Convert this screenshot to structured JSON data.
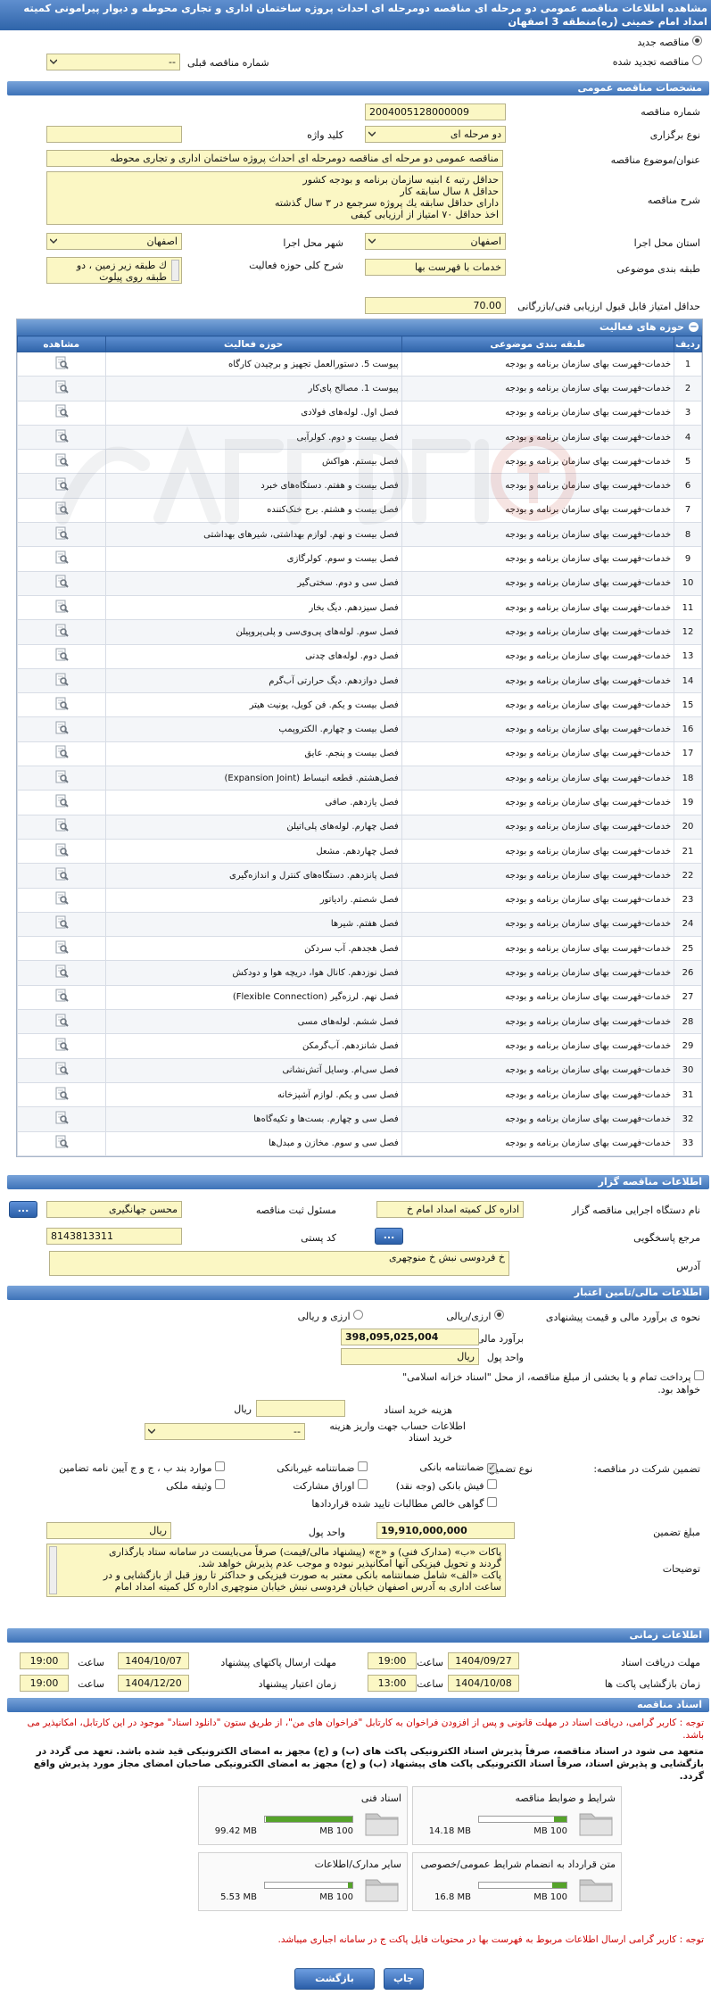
{
  "colors": {
    "panel_head": "#3a73b5",
    "field": "#fbf7c4",
    "accent_red": "#cc0000"
  },
  "header": {
    "line1": "مشاهده اطلاعات مناقصه عمومی دو مرحله ای مناقصه دومرحله ای احداث پروژه ساختمان اداری و تجاری محوطه و دیوار پیرامونی کمیته",
    "line2": "امداد امام خمینی (ره)منطقه 3 اصفهان",
    "radio_new": "مناقصه جدید",
    "radio_renewed": "مناقصه تجدید شده",
    "prev_number_label": "شماره مناقصه قبلی",
    "prev_number_value": "--"
  },
  "general": {
    "section_title": "مشخصات مناقصه عمومی",
    "number_label": "شماره مناقصه",
    "number_value": "2004005128000009",
    "type_label": "نوع برگزاری",
    "type_value": "دو مرحله ای",
    "keyword_label": "کلید واژه",
    "keyword_value": "",
    "subject_label": "عنوان/موضوع مناقصه",
    "subject_value": "مناقصه عمومی دو مرحله ای مناقصه دومرحله ای احداث پروژه ساختمان اداری و تجاری محوطه",
    "desc_label": "شرح مناقصه",
    "desc_lines": [
      "حداقل رتبه ٤ ابنیه سازمان برنامه و بودجه کشور",
      "حداقل ٨ سال سابقه کار",
      "دارای حداقل سابقه یك پروژه سرجمع در ٣ سال گذشته",
      "اخذ حداقل ٧٠ امتیاز از ارزیابی کیفی"
    ],
    "province_label": "استان محل اجرا",
    "province_value": "اصفهان",
    "city_label": "شهر محل اجرا",
    "city_value": "اصفهان",
    "category_label": "طبقه بندی موضوعی",
    "category_value": "خدمات با فهرست بها",
    "scope_label": "شرح کلی حوزه فعالیت",
    "scope_lines": [
      "ك طبقه زیر زمین ، دو",
      "طبقه روی پیلوت"
    ],
    "minscore_label": "حداقل امتیاز قابل قبول ارزیابی فنی/بازرگانی",
    "minscore_value": "70.00"
  },
  "activities": {
    "title": "حوزه های فعالیت",
    "toggle": "−",
    "headers": [
      "ردیف",
      "طبقه بندی موضوعی",
      "حوزه فعالیت",
      "مشاهده"
    ],
    "category_text": "خدمات-فهرست بهای سازمان برنامه و بودجه",
    "scopes": [
      "پیوست 5. دستورالعمل تجهیز و برچیدن کارگاه",
      "پیوست 1. مصالح پای‌کار",
      "فصل اول. لوله‌های فولادی",
      "فصل بیست و دوم. کولرآبی",
      "فصل بیستم. هواکش",
      "فصل بیست و هفتم. دستگاه‌های خبرد",
      "فصل بیست و هشتم. برج خنک‌کننده",
      "فصل بیست و نهم. لوازم بهداشتی، شیرهای بهداشتی",
      "فصل بیست و سوم. کولرگازی",
      "فصل سی و دوم. سختی‌گیر",
      "فصل سیزدهم. دیگ بخار",
      "فصل سوم. لوله‌های پی‌وی‌سی و پلی‌پروپیلن",
      "فصل دوم. لوله‌های چدنی",
      "فصل دوازدهم. دیگ حرارتی آب‌گرم",
      "فصل بیست و یکم. فن کویل، یونیت هیتر",
      "فصل بیست و چهارم. الکتروپمپ",
      "فصل بیست و پنجم. عایق",
      "فصل‌هشتم. قطعه انبساط (Expansion Joint)",
      "فصل یازدهم. صافی",
      "فصل چهارم. لوله‌های پلی‌اتیلن",
      "فصل چهاردهم. مشعل",
      "فصل پانزدهم. دستگاه‌های کنترل و اندازه‌گیری",
      "فصل شصتم. رادیاتور",
      "فصل هفتم. شیرها",
      "فصل هجدهم. آب سردکن",
      "فصل نوزدهم. کانال هوا، دریچه هوا و دودکش",
      "فصل نهم. لرزه‌گیر (Flexible Connection)",
      "فصل ششم. لوله‌های مسی",
      "فصل شانزدهم. آب‌گرمکن",
      "فصل سی‌ام. وسایل آتش‌نشانی",
      "فصل سی و یکم. لوازم آشپزخانه",
      "فصل سی و چهارم. بست‌ها و تکیه‌گاه‌ها",
      "فصل سی و سوم. مخازن و مبدل‌ها"
    ]
  },
  "organizer": {
    "section_title": "اطلاعات مناقصه گزار",
    "device_label": "نام دستگاه اجرایی مناقصه گزار",
    "device_value": "اداره کل کمیته امداد امام خ",
    "officer_label": "مسئول ثبت مناقصه",
    "officer_value": "محسن جهانگیری",
    "ref_label": "مرجع پاسخگویی",
    "ref_btn": "...",
    "officer_btn": "...",
    "postal_label": "کد پستی",
    "postal_value": "8143813311",
    "address_label": "آدرس",
    "address_value": "خ فردوسی نبش خ منوچهری"
  },
  "finance": {
    "section_title": "اطلاعات مالی/تامین اعتبار",
    "estimate_type_label": "نحوه ی برآورد مالی و قیمت پیشنهادی",
    "opt_fx": "ارزی/ریالی",
    "opt_fx_rial": "ارزی و ریالی",
    "estimate_label": "برآورد مالی",
    "estimate_value": "398,095,025,004",
    "unit_label": "واحد پول",
    "unit_value": "ریال",
    "treasury_text": "پرداخت تمام و یا بخشی از مبلغ مناقصه، از محل \"اسناد خزانه اسلامی\"",
    "treasury_text2": "خواهد بود.",
    "doc_fee_label": "هزینه خرید اسناد",
    "doc_fee_unit": "ریال",
    "account_label": "اطلاعات حساب جهت واریز هزینه",
    "account_label2": "خرید اسناد",
    "account_value": "--",
    "guarantee_label": "تضمین شرکت در مناقصه:",
    "guarantee_type_label": "نوع تضمین",
    "g_opts": [
      "ضمانتنامه بانکی",
      "ضمانتنامه غیربانکی",
      "موارد بند ب ، ج و ج آیین نامه تضامین",
      "فیش بانکی (وجه نقد)",
      "اوراق مشارکت",
      "وثیقه ملکی",
      "گواهی خالص مطالبات تایید شده قراردادها"
    ],
    "g_amount_label": "مبلغ تضمین",
    "g_amount_value": "19,910,000,000",
    "g_unit_label": "واحد پول",
    "g_unit_value": "ریال",
    "desc_label": "توضیحات",
    "desc_lines": [
      "پاکات «ب» (مدارک فنی) و «ج» (پیشنهاد مالی/قیمت) صرفاً می‌بایست در سامانه ستاد بارگذاری",
      "گردند و تحویل فیزیکی آنها امکانپذیر نبوده و موجب عدم پذیرش خواهد شد.",
      "پاکت «الف» شامل ضمانتنامه بانکی معتبر به صورت فیزیکی و حداکثر تا روز قبل از بازگشایی و در",
      "ساعت اداری به آدرس اصفهان خیابان فردوسی نبش خیابان منوچهری اداره کل کمیته امداد امام"
    ]
  },
  "timing": {
    "section_title": "اطلاعات زمانی",
    "receive_label": "مهلت دریافت اسناد",
    "receive_date": "1404/09/27",
    "receive_time_label": "ساعت",
    "receive_time": "19:00",
    "send_label": "مهلت ارسال پاکتهای پیشنهاد",
    "send_date": "1404/10/07",
    "send_time_label": "ساعت",
    "send_time": "19:00",
    "open_label": "زمان بازگشایی پاکت ها",
    "open_date": "1404/10/08",
    "open_time_label": "ساعت",
    "open_time": "13:00",
    "validity_label": "زمان اعتبار پیشنهاد",
    "validity_date": "1404/12/20",
    "validity_time_label": "ساعت",
    "validity_time": "19:00"
  },
  "docs": {
    "section_title": "اسناد مناقصه",
    "notice_red": "توجه : کاربر گرامی، دریافت اسناد در مهلت قانونی و پس از افزودن فراخوان به کارتابل \"فراخوان های من\"، از طریق ستون \"دانلود اسناد\" موجود در این کارتابل، امکانپذیر می باشد.",
    "notice_black": "متعهد می شود در اسناد مناقصه، صرفاً پذیرش اسناد الکترونیکی پاکت های (ب) و (ج) مجهز به امضای الکترونیکی قید شده باشد. تعهد می گردد در بازگشایی و پذیرش اسناد، صرفاً اسناد الکترونیکی پاکت های پیشنهاد (ب) و (ج) مجهز به امضای الکترونیکی صاحبان امضای مجاز مورد پذیرش واقع گردد.",
    "files": [
      {
        "name": "شرایط و ضوابط مناقصه",
        "size": "14.18 MB",
        "max": "100 MB",
        "fraction": 0.1418
      },
      {
        "name": "اسناد فنی",
        "size": "99.42 MB",
        "max": "100 MB",
        "fraction": 0.9942
      },
      {
        "name": "متن قرارداد به انضمام شرایط عمومی/خصوصی",
        "size": "16.8 MB",
        "max": "100 MB",
        "fraction": 0.168
      },
      {
        "name": "سایر مدارک/اطلاعات",
        "size": "5.53 MB",
        "max": "100 MB",
        "fraction": 0.0553
      }
    ],
    "footer_notice": "توجه : کاربر گرامی ارسال اطلاعات مربوط به فهرست بها در محتویات فایل پاکت ج در سامانه اجباری میباشد."
  },
  "footer": {
    "back_label": "بازگشت",
    "print_label": "چاپ"
  }
}
